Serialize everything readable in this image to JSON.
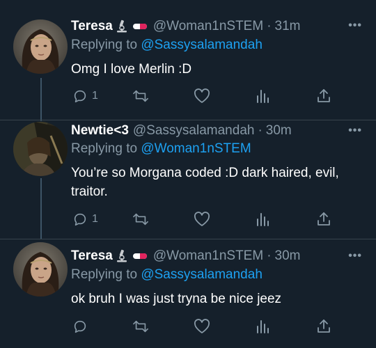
{
  "tweets": [
    {
      "name": "Teresa",
      "badge_icons": [
        "microscope-icon",
        "pill-icon"
      ],
      "handle": "@Woman1nSTEM",
      "separator": "·",
      "time": "31m",
      "replying_prefix": "Replying to",
      "replying_to": "@Sassysalamandah",
      "text": "Omg I love Merlin :D",
      "reply_count": "1",
      "retweet_count": "",
      "like_count": ""
    },
    {
      "name": "Newtie<3",
      "badge_icons": [],
      "handle": "@Sassysalamandah",
      "separator": "·",
      "time": "30m",
      "replying_prefix": "Replying to",
      "replying_to": "@Woman1nSTEM",
      "text": "You’re so Morgana coded :D dark haired, evil, traitor.",
      "reply_count": "1",
      "retweet_count": "",
      "like_count": ""
    },
    {
      "name": "Teresa",
      "badge_icons": [
        "microscope-icon",
        "pill-icon"
      ],
      "handle": "@Woman1nSTEM",
      "separator": "·",
      "time": "30m",
      "replying_prefix": "Replying to",
      "replying_to": "@Sassysalamandah",
      "text": "ok bruh I was just tryna be nice jeez",
      "reply_count": "",
      "retweet_count": "",
      "like_count": ""
    }
  ],
  "more_icon": "more-horizontal-icon",
  "action_icons": [
    "reply-icon",
    "retweet-icon",
    "like-icon",
    "analytics-icon",
    "share-icon"
  ],
  "colors": {
    "background": "#15202b",
    "divider": "#38444d",
    "primary_text": "#ffffff",
    "secondary_text": "#8899a6",
    "link": "#1da1f2"
  }
}
